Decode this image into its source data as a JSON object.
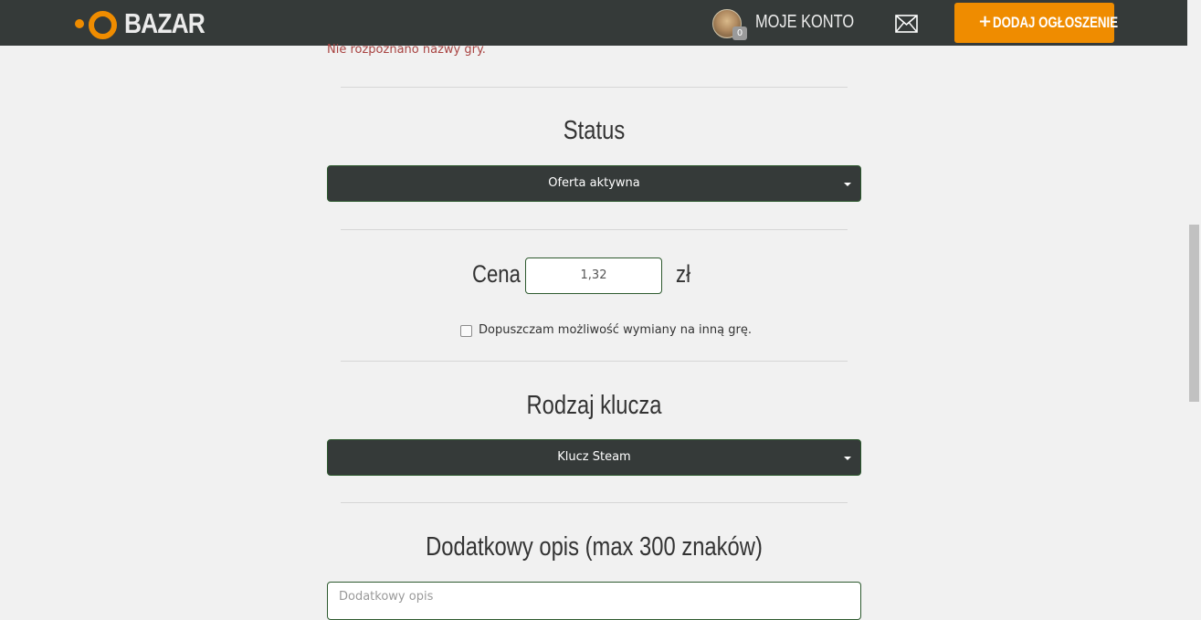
{
  "header": {
    "logo_text": "BAZAR",
    "account_label": "MOJE KONTO",
    "account_badge": "0",
    "add_button_label": "DODAJ OGŁOSZENIE",
    "accent_color": "#ef8c00",
    "bar_color": "#353a39"
  },
  "form": {
    "game_error": "Nie rozpoznano nazwy gry.",
    "status": {
      "title": "Status",
      "selected": "Oferta aktywna"
    },
    "price": {
      "label": "Cena",
      "value": "1,32",
      "currency": "zł",
      "exchange_label": "Dopuszczam możliwość wymiany na inną grę."
    },
    "key_type": {
      "title": "Rodzaj klucza",
      "selected": "Klucz Steam"
    },
    "description": {
      "title": "Dodatkowy opis (max 300 znaków)",
      "placeholder": "Dodatkowy opis"
    }
  }
}
